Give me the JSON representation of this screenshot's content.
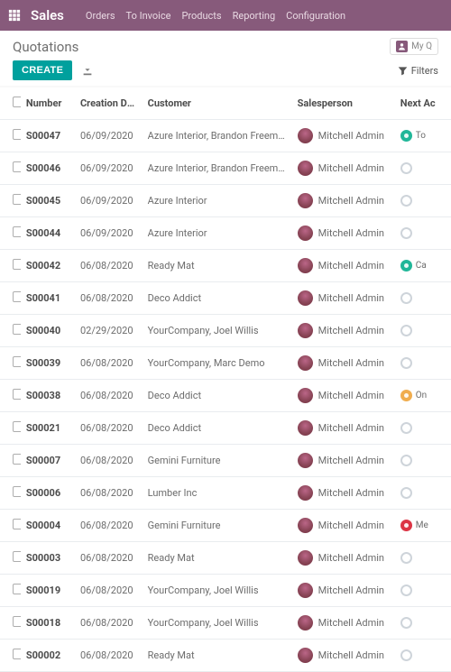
{
  "nav": {
    "brand": "Sales",
    "links": [
      "Orders",
      "To Invoice",
      "Products",
      "Reporting",
      "Configuration"
    ]
  },
  "cp": {
    "breadcrumb": "Quotations",
    "my_quotations": "My Q",
    "create": "CREATE",
    "filters": "Filters"
  },
  "table": {
    "headers": {
      "number": "Number",
      "creation_date": "Creation Date",
      "customer": "Customer",
      "salesperson": "Salesperson",
      "next_activity": "Next Ac"
    },
    "rows": [
      {
        "num": "S00047",
        "date": "06/09/2020",
        "customer": "Azure Interior, Brandon Freeman",
        "sp": "Mitchell Admin",
        "act": {
          "status": "green",
          "label": "To"
        }
      },
      {
        "num": "S00046",
        "date": "06/09/2020",
        "customer": "Azure Interior, Brandon Freeman",
        "sp": "Mitchell Admin",
        "act": {
          "status": "none",
          "label": ""
        }
      },
      {
        "num": "S00045",
        "date": "06/09/2020",
        "customer": "Azure Interior",
        "sp": "Mitchell Admin",
        "act": {
          "status": "none",
          "label": ""
        }
      },
      {
        "num": "S00044",
        "date": "06/09/2020",
        "customer": "Azure Interior",
        "sp": "Mitchell Admin",
        "act": {
          "status": "none",
          "label": ""
        }
      },
      {
        "num": "S00042",
        "date": "06/08/2020",
        "customer": "Ready Mat",
        "sp": "Mitchell Admin",
        "act": {
          "status": "green",
          "label": "Ca"
        }
      },
      {
        "num": "S00041",
        "date": "06/08/2020",
        "customer": "Deco Addict",
        "sp": "Mitchell Admin",
        "act": {
          "status": "none",
          "label": ""
        }
      },
      {
        "num": "S00040",
        "date": "02/29/2020",
        "customer": "YourCompany, Joel Willis",
        "sp": "Mitchell Admin",
        "act": {
          "status": "none",
          "label": ""
        }
      },
      {
        "num": "S00039",
        "date": "06/08/2020",
        "customer": "YourCompany, Marc Demo",
        "sp": "Mitchell Admin",
        "act": {
          "status": "none",
          "label": ""
        }
      },
      {
        "num": "S00038",
        "date": "06/08/2020",
        "customer": "Deco Addict",
        "sp": "Mitchell Admin",
        "act": {
          "status": "yellow",
          "label": "On"
        }
      },
      {
        "num": "S00021",
        "date": "06/08/2020",
        "customer": "Deco Addict",
        "sp": "Mitchell Admin",
        "act": {
          "status": "none",
          "label": ""
        }
      },
      {
        "num": "S00007",
        "date": "06/08/2020",
        "customer": "Gemini Furniture",
        "sp": "Mitchell Admin",
        "act": {
          "status": "none",
          "label": ""
        }
      },
      {
        "num": "S00006",
        "date": "06/08/2020",
        "customer": "Lumber Inc",
        "sp": "Mitchell Admin",
        "act": {
          "status": "none",
          "label": ""
        }
      },
      {
        "num": "S00004",
        "date": "06/08/2020",
        "customer": "Gemini Furniture",
        "sp": "Mitchell Admin",
        "act": {
          "status": "red",
          "label": "Me"
        }
      },
      {
        "num": "S00003",
        "date": "06/08/2020",
        "customer": "Ready Mat",
        "sp": "Mitchell Admin",
        "act": {
          "status": "none",
          "label": ""
        }
      },
      {
        "num": "S00019",
        "date": "06/08/2020",
        "customer": "YourCompany, Joel Willis",
        "sp": "Mitchell Admin",
        "act": {
          "status": "none",
          "label": ""
        }
      },
      {
        "num": "S00018",
        "date": "06/08/2020",
        "customer": "YourCompany, Joel Willis",
        "sp": "Mitchell Admin",
        "act": {
          "status": "none",
          "label": ""
        }
      },
      {
        "num": "S00002",
        "date": "06/08/2020",
        "customer": "Ready Mat",
        "sp": "Mitchell Admin",
        "act": {
          "status": "none",
          "label": ""
        }
      }
    ]
  }
}
